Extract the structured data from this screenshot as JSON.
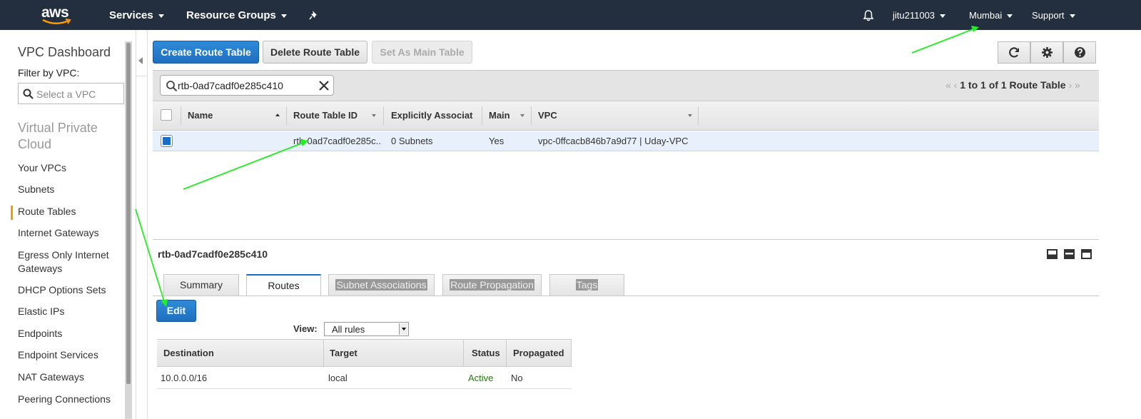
{
  "topbar": {
    "logo_text": "aws",
    "services_label": "Services",
    "resource_groups_label": "Resource Groups",
    "user_label": "jitu211003",
    "region_label": "Mumbai",
    "support_label": "Support"
  },
  "sidebar": {
    "title": "VPC Dashboard",
    "filter_label": "Filter by VPC:",
    "filter_placeholder": "Select a VPC",
    "section_title": "Virtual Private Cloud",
    "items": [
      {
        "label": "Your VPCs"
      },
      {
        "label": "Subnets"
      },
      {
        "label": "Route Tables"
      },
      {
        "label": "Internet Gateways"
      },
      {
        "label": "Egress Only Internet Gateways"
      },
      {
        "label": "DHCP Options Sets"
      },
      {
        "label": "Elastic IPs"
      },
      {
        "label": "Endpoints"
      },
      {
        "label": "Endpoint Services"
      },
      {
        "label": "NAT Gateways"
      },
      {
        "label": "Peering Connections"
      }
    ]
  },
  "toolbar": {
    "create_label": "Create Route Table",
    "delete_label": "Delete Route Table",
    "set_main_label": "Set As Main Table"
  },
  "search": {
    "value": "rtb-0ad7cadf0e285c410"
  },
  "pager": {
    "text": "1 to 1 of 1 Route Table"
  },
  "grid": {
    "columns": [
      "Name",
      "Route Table ID",
      "Explicitly Associat",
      "Main",
      "VPC"
    ],
    "rows": [
      {
        "name": "",
        "id": "rtb-0ad7cadf0e285c...",
        "explicit": "0 Subnets",
        "main": "Yes",
        "vpc": "vpc-0ffcacb846b7a9d77 | Uday-VPC"
      }
    ]
  },
  "detail": {
    "title": "rtb-0ad7cadf0e285c410",
    "tabs": [
      "Summary",
      "Routes",
      "Subnet Associations",
      "Route Propagation",
      "Tags"
    ],
    "edit_label": "Edit",
    "view_label": "View:",
    "view_value": "All rules"
  },
  "routes": {
    "columns": [
      "Destination",
      "Target",
      "Status",
      "Propagated"
    ],
    "rows": [
      {
        "destination": "10.0.0.0/16",
        "target": "local",
        "status": "Active",
        "propagated": "No"
      }
    ]
  },
  "colors": {
    "header_bg": "#232f3e",
    "primary": "#1f6fbf",
    "active_status": "#1d8102",
    "annotation_arrow": "#22ee22",
    "sidebar_active": "#ff9900"
  }
}
